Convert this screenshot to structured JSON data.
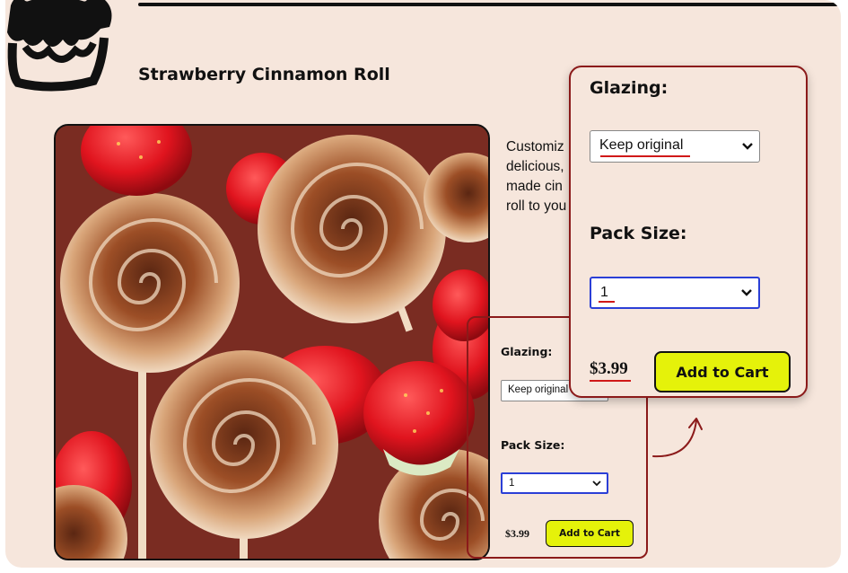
{
  "product": {
    "title": "Strawberry Cinnamon Roll",
    "description_lines": [
      "Customiz",
      "delicious,",
      "made cin",
      "roll to you"
    ]
  },
  "options": {
    "glazing_label": "Glazing:",
    "glazing_value": "Keep original",
    "pack_label": "Pack Size:",
    "pack_value": "1"
  },
  "cart": {
    "price": "$3.99",
    "add_label": "Add to Cart"
  },
  "colors": {
    "background": "#f6e6dc",
    "button": "#e5f20a",
    "highlight": "#8b1a1a",
    "focus": "#2b3fd6",
    "underline": "#d01818"
  },
  "icons": [
    "cinnamon-roll-logo",
    "chevron-down-icon",
    "curved-arrow-icon"
  ]
}
